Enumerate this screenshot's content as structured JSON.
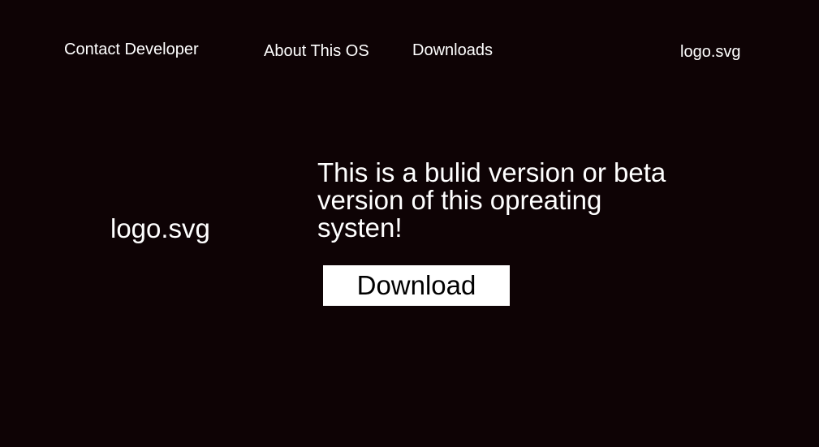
{
  "nav": {
    "contact_label": "Contact Developer",
    "about_label": "About This OS",
    "downloads_label": "Downloads",
    "logo_alt": "logo.svg"
  },
  "hero": {
    "logo_alt": "logo.svg",
    "description": "This is a bulid version or beta version of this opreating systen!",
    "download_label": "Download"
  },
  "colors": {
    "background": "#0e0305",
    "text": "#ffffff",
    "button_bg": "#ffffff",
    "button_text": "#000000"
  }
}
